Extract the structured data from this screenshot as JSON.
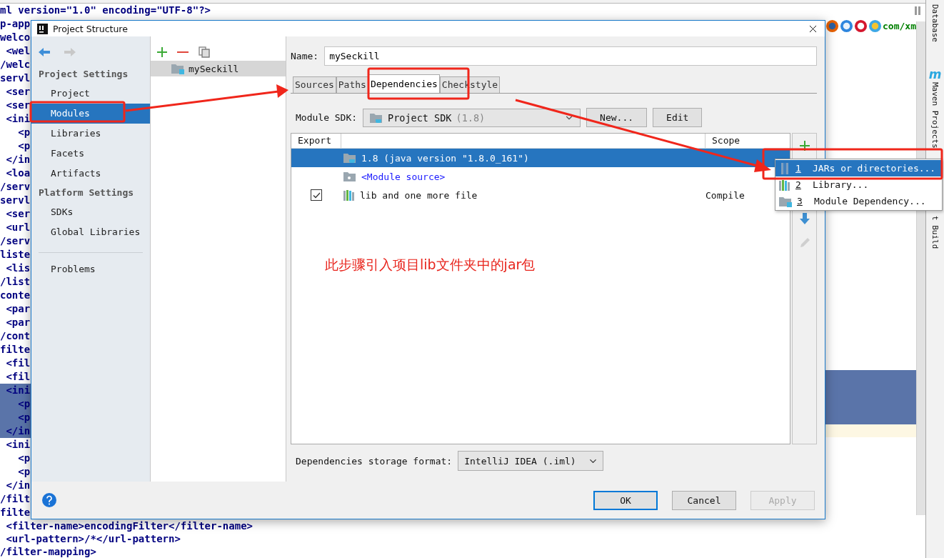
{
  "editor": {
    "top_line": "ml version=\"1.0\" encoding=\"UTF-8\"?>",
    "url_fragment": "com/xm",
    "left_lines": [
      {
        "text": "p-app",
        "selected": false
      },
      {
        "text": "welco",
        "selected": false
      },
      {
        "text": " <wel",
        "selected": false
      },
      {
        "text": "/welc",
        "selected": false
      },
      {
        "text": "servl",
        "selected": false
      },
      {
        "text": " <ser",
        "selected": false
      },
      {
        "text": " <ser",
        "selected": false
      },
      {
        "text": " <ini",
        "selected": false
      },
      {
        "text": "   <p",
        "selected": false
      },
      {
        "text": "   <p",
        "selected": false
      },
      {
        "text": " </in",
        "selected": false
      },
      {
        "text": " <loa",
        "selected": false
      },
      {
        "text": "/serv",
        "selected": false
      },
      {
        "text": "servl",
        "selected": false
      },
      {
        "text": " <ser",
        "selected": false
      },
      {
        "text": " <url",
        "selected": false
      },
      {
        "text": "/serv",
        "selected": false
      },
      {
        "text": "liste",
        "selected": false
      },
      {
        "text": " <lis",
        "selected": false
      },
      {
        "text": "/list",
        "selected": false
      },
      {
        "text": "conte",
        "selected": false
      },
      {
        "text": " <par",
        "selected": false
      },
      {
        "text": " <par",
        "selected": false
      },
      {
        "text": "/cont",
        "selected": false
      },
      {
        "text": "filte",
        "selected": false
      },
      {
        "text": " <fil",
        "selected": false
      },
      {
        "text": " <fil",
        "selected": false
      },
      {
        "text": " <ini",
        "selected": true
      },
      {
        "text": "   <p",
        "selected": true
      },
      {
        "text": "   <p",
        "selected": true
      },
      {
        "text": " </in",
        "selected": true
      },
      {
        "text": " <ini",
        "selected": false
      },
      {
        "text": "   <p",
        "selected": false
      },
      {
        "text": "   <p",
        "selected": false
      },
      {
        "text": " </in",
        "selected": false
      },
      {
        "text": "/filt",
        "selected": false
      },
      {
        "text": "filte",
        "selected": false
      }
    ],
    "bottom_lines": [
      " <filter-name>encodingFilter</filter-name>",
      " <url-pattern>/*</url-pattern>",
      "/filter-mapping>"
    ]
  },
  "side_panel": {
    "tool_windows": [
      {
        "label": "Database"
      },
      {
        "label": "Maven Projects",
        "badge": "m"
      },
      {
        "label": "t Build"
      }
    ]
  },
  "dialog": {
    "title": "Project Structure",
    "sidebar": [
      {
        "heading": "Project Settings",
        "items": [
          {
            "label": "Project",
            "selected": false
          },
          {
            "label": "Modules",
            "selected": true
          },
          {
            "label": "Libraries",
            "selected": false
          },
          {
            "label": "Facets",
            "selected": false
          },
          {
            "label": "Artifacts",
            "selected": false
          }
        ]
      },
      {
        "heading": "Platform Settings",
        "items": [
          {
            "label": "SDKs",
            "selected": false
          },
          {
            "label": "Global Libraries",
            "selected": false
          }
        ]
      },
      {
        "items": [
          {
            "label": "Problems",
            "selected": false
          }
        ]
      }
    ],
    "modules": [
      {
        "name": "mySeckill",
        "selected": true
      }
    ],
    "name_field": {
      "label": "Name:",
      "value": "mySeckill"
    },
    "tabs": [
      {
        "label": "Sources",
        "selected": false
      },
      {
        "label": "Paths",
        "selected": false
      },
      {
        "label": "Dependencies",
        "selected": true
      },
      {
        "label": "Checkstyle",
        "selected": false
      }
    ],
    "module_sdk": {
      "label": "Module SDK:",
      "value": "Project SDK",
      "version": "(1.8)",
      "buttons": [
        "New...",
        "Edit"
      ]
    },
    "table": {
      "columns": {
        "export": "Export",
        "scope": "Scope"
      },
      "rows": [
        {
          "kind": "sdk",
          "name": "1.8 (java version \"1.8.0_161\")",
          "selected": true
        },
        {
          "kind": "source",
          "name": "<Module source>",
          "selected": false
        },
        {
          "kind": "library",
          "name": "lib and one more file",
          "scope": "Compile",
          "exported": true,
          "selected": false
        }
      ]
    },
    "add_menu": [
      {
        "number": "1",
        "label": "JARs or directories...",
        "kind": "jars",
        "selected": true
      },
      {
        "number": "2",
        "label": "Library...",
        "kind": "library",
        "selected": false
      },
      {
        "number": "3",
        "label": "Module Dependency...",
        "kind": "module",
        "selected": false
      }
    ],
    "storage_format": {
      "label": "Dependencies storage format:",
      "value": "IntelliJ IDEA (.iml)"
    },
    "buttons": [
      {
        "label": "OK",
        "kind": "default",
        "disabled": false
      },
      {
        "label": "Cancel",
        "kind": "normal",
        "disabled": false
      },
      {
        "label": "Apply",
        "kind": "normal",
        "disabled": true
      }
    ]
  },
  "annotation": {
    "text": "此步骤引入项目lib文件夹中的jar包"
  }
}
